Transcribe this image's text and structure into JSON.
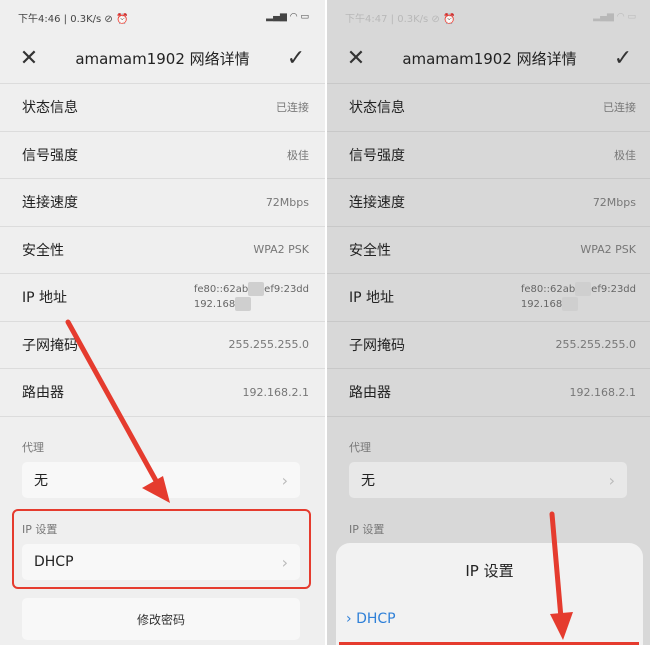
{
  "left": {
    "status": {
      "time": "下午4:46",
      "speed": "0.3K/s",
      "icons": "▂▄▆ ◠ ▭"
    },
    "header": {
      "title": "amamam1902  网络详情"
    },
    "rows": [
      {
        "label": "状态信息",
        "value": "已连接"
      },
      {
        "label": "信号强度",
        "value": "极佳"
      },
      {
        "label": "连接速度",
        "value": "72Mbps"
      },
      {
        "label": "安全性",
        "value": "WPA2 PSK"
      },
      {
        "label": "IP 地址",
        "value1a": "fe80::62ab",
        "value1b": "ef9:23dd",
        "value2": "192.168"
      },
      {
        "label": "子网掩码",
        "value": "255.255.255.0"
      },
      {
        "label": "路由器",
        "value": "192.168.2.1"
      }
    ],
    "proxy": {
      "section": "代理",
      "value": "无"
    },
    "ip": {
      "section": "IP 设置",
      "value": "DHCP"
    },
    "password_button": "修改密码"
  },
  "right": {
    "status": {
      "time": "下午4:47",
      "speed": "0.3K/s",
      "icons": "▂▄▆ ◠ ▭"
    },
    "header": {
      "title": "amamam1902  网络详情"
    },
    "rows": [
      {
        "label": "状态信息",
        "value": "已连接"
      },
      {
        "label": "信号强度",
        "value": "极佳"
      },
      {
        "label": "连接速度",
        "value": "72Mbps"
      },
      {
        "label": "安全性",
        "value": "WPA2 PSK"
      },
      {
        "label": "IP 地址",
        "value1a": "fe80::62ab",
        "value1b": "ef9:23dd",
        "value2": "192.168"
      },
      {
        "label": "子网掩码",
        "value": "255.255.255.0"
      },
      {
        "label": "路由器",
        "value": "192.168.2.1"
      }
    ],
    "proxy": {
      "section": "代理",
      "value": "无"
    },
    "ip": {
      "section": "IP 设置"
    },
    "sheet": {
      "title": "IP  设置",
      "option": "DHCP"
    }
  },
  "colors": {
    "annotation_red": "#e53b2e",
    "accent_blue": "#2f80d8"
  },
  "icons": {
    "close": "close-icon",
    "confirm": "check-icon",
    "chevron": "chevron-right-icon",
    "selected": "chevron-right-icon"
  }
}
